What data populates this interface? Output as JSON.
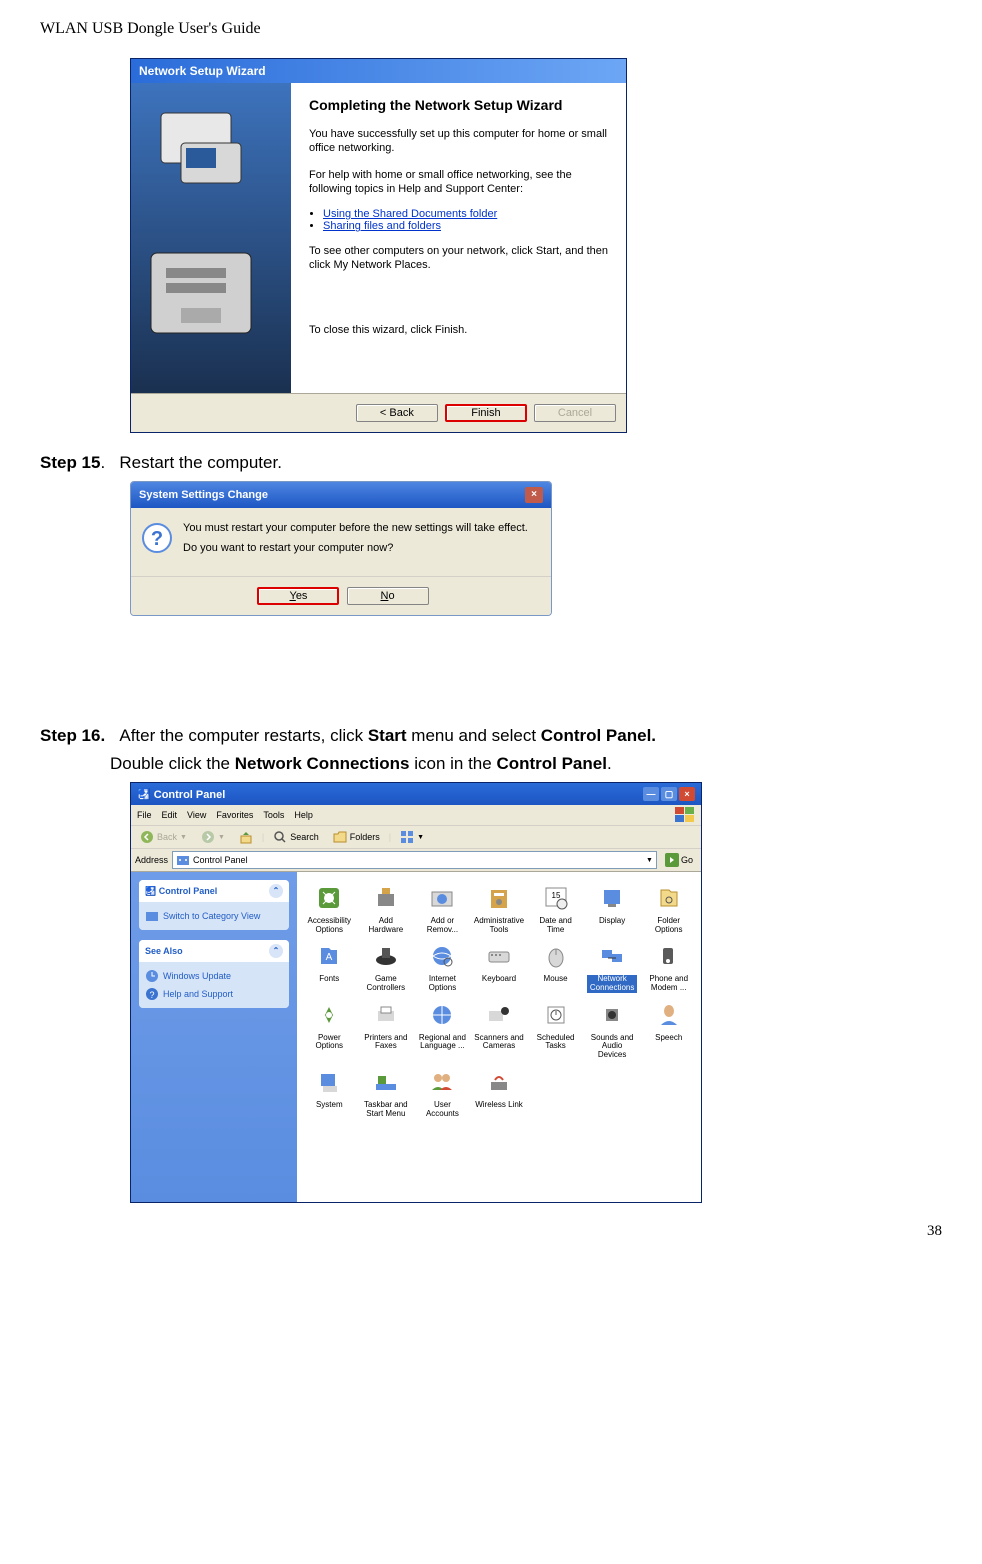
{
  "header": "WLAN USB Dongle User's Guide",
  "page_number": "38",
  "wizard": {
    "title": "Network Setup Wizard",
    "heading": "Completing the Network Setup Wizard",
    "p1": "You have successfully set up this computer for home or small office networking.",
    "p2": "For help with home or small office networking, see the following topics in Help and Support Center:",
    "link1": "Using the Shared Documents folder",
    "link2": "Sharing files and folders",
    "p3": "To see other computers on your network, click Start, and then click My Network Places.",
    "p4": "To close this wizard, click Finish.",
    "back": "< Back",
    "finish": "Finish",
    "cancel": "Cancel"
  },
  "step15": {
    "label": "Step 15",
    "text": "Restart the computer."
  },
  "sysdialog": {
    "title": "System Settings Change",
    "line1": "You must restart your computer before the new settings will take effect.",
    "line2": "Do you want to restart your computer now?",
    "yes": "Yes",
    "no": "No"
  },
  "step16": {
    "label": "Step 16.",
    "text_pre": "After the computer restarts, click ",
    "start": "Start",
    "text_mid": " menu and select ",
    "cp": "Control Panel.",
    "line2_pre": "Double click the ",
    "nc": "Network Connections",
    "line2_mid": " icon in the ",
    "cp2": "Control Panel",
    "line2_end": "."
  },
  "cp": {
    "title": "Control Panel",
    "menu": [
      "File",
      "Edit",
      "View",
      "Favorites",
      "Tools",
      "Help"
    ],
    "toolbar": {
      "back": "Back",
      "search": "Search",
      "folders": "Folders"
    },
    "address_label": "Address",
    "address_value": "Control Panel",
    "go": "Go",
    "side1_title": "Control Panel",
    "side1_item": "Switch to Category View",
    "side2_title": "See Also",
    "side2_item1": "Windows Update",
    "side2_item2": "Help and Support",
    "items": [
      "Accessibility Options",
      "Add Hardware",
      "Add or Remov...",
      "Administrative Tools",
      "Date and Time",
      "Display",
      "Folder Options",
      "Fonts",
      "Game Controllers",
      "Internet Options",
      "Keyboard",
      "Mouse",
      "Network Connections",
      "Phone and Modem ...",
      "Power Options",
      "Printers and Faxes",
      "Regional and Language ...",
      "Scanners and Cameras",
      "Scheduled Tasks",
      "Sounds and Audio Devices",
      "Speech",
      "System",
      "Taskbar and Start Menu",
      "User Accounts",
      "Wireless Link"
    ]
  }
}
